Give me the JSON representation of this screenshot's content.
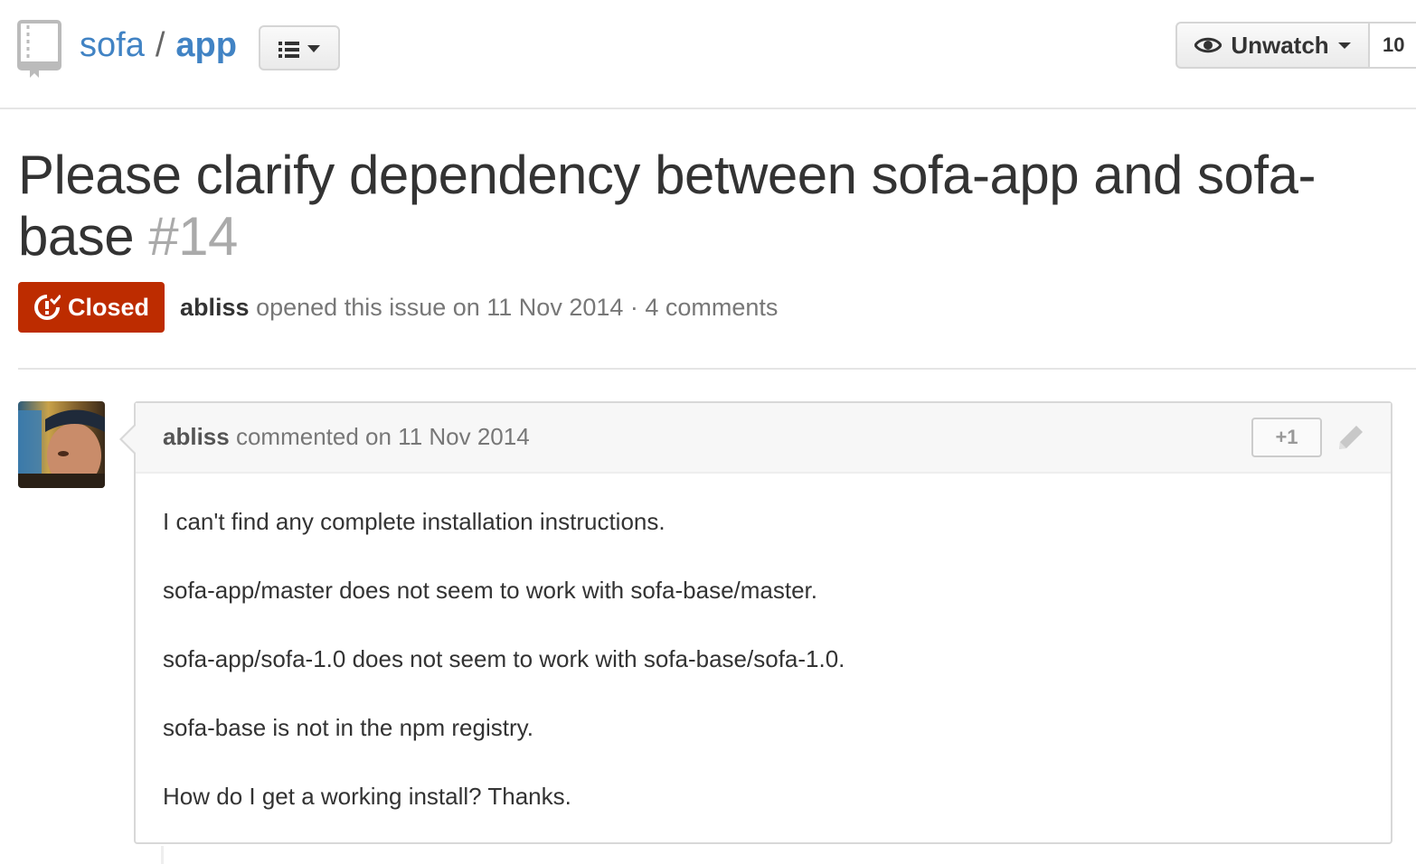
{
  "repo": {
    "owner": "sofa",
    "separator": "/",
    "name": "app",
    "icon": "repo-book-icon"
  },
  "menu_button": {
    "icon": "list-icon"
  },
  "watch": {
    "label": "Unwatch",
    "count": "10",
    "icon": "eye-icon"
  },
  "issue": {
    "title": "Please clarify dependency between sofa-app and sofa-base",
    "number": "#14",
    "state": "Closed",
    "state_color": "#bd2c00",
    "author": "abliss",
    "opened_text": "opened this issue on 11 Nov 2014 · 4 comments"
  },
  "comment": {
    "author": "abliss",
    "action": "commented on 11 Nov 2014",
    "reaction_label": "+1",
    "paragraphs": [
      "I can't find any complete installation instructions.",
      "sofa-app/master does not seem to work with sofa-base/master.",
      "sofa-app/sofa-1.0 does not seem to work with sofa-base/sofa-1.0.",
      "sofa-base is not in the npm registry.",
      "How do I get a working install? Thanks."
    ]
  }
}
